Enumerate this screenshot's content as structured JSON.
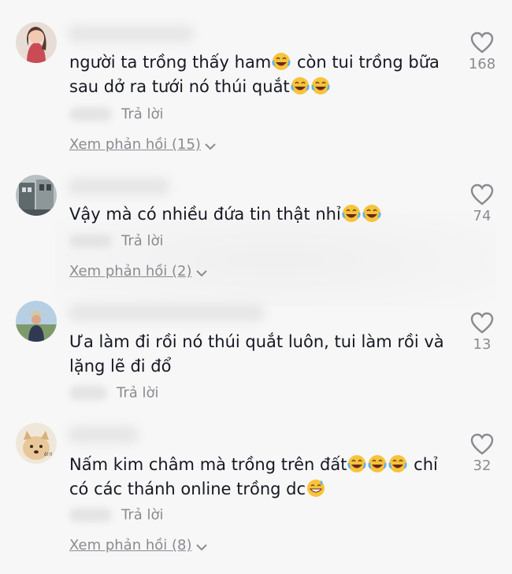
{
  "comments": [
    {
      "text_parts": [
        "người ta trồng thấy ham",
        "emoji:laughing",
        " còn tui trồng bữa sau dở ra tưới nó thúi quắt",
        "emoji:laughing",
        "emoji:laughing"
      ],
      "line1": "người ta trồng thấy ham",
      "line1b": " còn tui trồng bữa",
      "line2": "sau dở ra tưới nó thúi quắt",
      "reply_label": "Trả lời",
      "view_replies": "Xem phản hồi (15)",
      "likes": "168",
      "avatar_icon": "woman-portrait"
    },
    {
      "line1": "Vậy mà có nhiều đứa tin thật nhỉ",
      "reply_label": "Trả lời",
      "view_replies": "Xem phản hồi (2)",
      "likes": "74",
      "avatar_icon": "building-photo"
    },
    {
      "line1": "Ưa làm đi rồi nó thúi quắt luôn, tui làm rồi và",
      "line2": "lặng lẽ đi đổ",
      "reply_label": "Trả lời",
      "likes": "13",
      "avatar_icon": "person-outdoor"
    },
    {
      "line1": "Nấm kim châm mà trồng trên đất",
      "line1b": " chỉ",
      "line2": "có các thánh online trồng dc",
      "reply_label": "Trả lời",
      "view_replies": "Xem phản hồi (8)",
      "likes": "32",
      "avatar_icon": "dog-photo"
    }
  ],
  "colors": {
    "text": "#161823",
    "muted": "#8a8b91",
    "background": "#f7f7f7",
    "emoji": "#f7c33b"
  }
}
